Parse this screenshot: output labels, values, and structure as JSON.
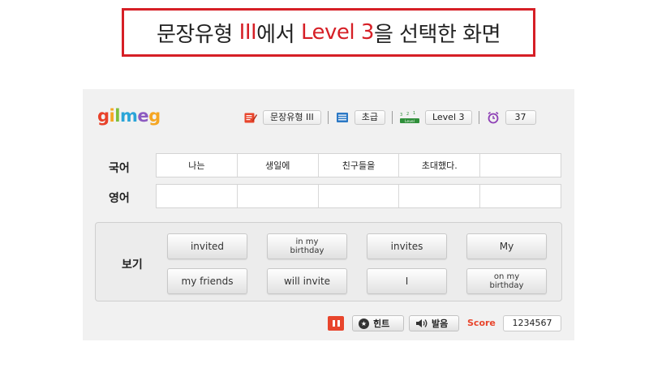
{
  "banner": {
    "part1": "문장유형",
    "roman": "III",
    "part2": "에서",
    "level": "Level 3",
    "part3": "을 선택한 화면"
  },
  "app": {
    "logo": {
      "g1": "g",
      "i": "i",
      "l": "l",
      "m": "m",
      "e": "e",
      "g2": "g"
    },
    "topbar": {
      "sentence_type": "문장유형 III",
      "difficulty": "초급",
      "level": "Level 3",
      "timer": "37",
      "level_icon_text": "Level"
    },
    "rows": {
      "korean_label": "국어",
      "english_label": "영어",
      "korean_cells": [
        "나는",
        "생일에",
        "친구들을",
        "초대했다.",
        ""
      ],
      "english_cells": [
        "",
        "",
        "",
        "",
        ""
      ]
    },
    "choices": {
      "label": "보기",
      "row1": [
        "invited",
        "in my birthday",
        "invites",
        "My"
      ],
      "row2": [
        "my friends",
        "will invite",
        "I",
        "on my birthday"
      ]
    },
    "controls": {
      "hint": "힌트",
      "pronounce": "발음",
      "score_label": "Score",
      "score_value": "1234567"
    }
  },
  "colors": {
    "accent_red": "#d61f26",
    "control_red": "#e8452c",
    "panel_bg": "#f1f1f1"
  },
  "icons": [
    "pencil-note-icon",
    "book-icon",
    "level-stairs-icon",
    "alarm-clock-icon",
    "pause-icon",
    "star-hint-icon",
    "speaker-icon"
  ]
}
